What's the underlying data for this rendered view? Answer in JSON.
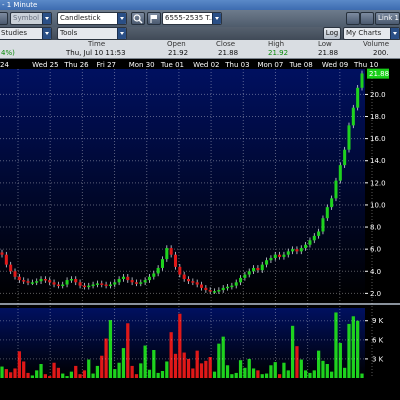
{
  "window": {
    "title": "- 1 Minute"
  },
  "toolbar": {
    "symbol_placeholder": "Symbol 2",
    "chart_type": "Candlestick",
    "account": "6555-2535 T...",
    "link": "Link 1",
    "studies": "Studies",
    "tools": "Tools",
    "log": "Log",
    "my_charts": "My Charts"
  },
  "quote": {
    "change": "4%)",
    "headers": {
      "time": "Time",
      "open": "Open",
      "close": "Close",
      "high": "High",
      "low": "Low",
      "volume": "Volume"
    },
    "values": {
      "time": "Thu, Jul 10  11:53",
      "open": "21.92",
      "close": "21.88",
      "high": "21.92",
      "low": "21.88",
      "volume": "200."
    }
  },
  "colors": {
    "up": "#1ed21e",
    "down": "#e01818",
    "plot_bg_top": "#001060",
    "plot_bg_bottom": "#000000",
    "last_price_bg": "#18d018"
  },
  "chart_data": {
    "type": "candlestick",
    "x_labels": [
      "24",
      "Wed 25",
      "Thu 26",
      "Fri 27",
      "Mon 30",
      "Tue 01",
      "Wed 02",
      "Thu 03",
      "Mon 07",
      "Tue 08",
      "Wed 09",
      "Thu 10"
    ],
    "y_ticks": [
      "2.0",
      "4.0",
      "6.0",
      "8.0",
      "10.0",
      "12.0",
      "14.0",
      "16.0",
      "18.0",
      "20.0"
    ],
    "ylim": [
      1.4,
      22.3
    ],
    "last_price": "21.88",
    "volume_ticks": [
      "3 K",
      "6 K",
      "9 K"
    ],
    "volume_ylim": [
      0,
      11000
    ],
    "series": [
      {
        "values": [
          5.5,
          4.6,
          4.0,
          3.5,
          3.2,
          3.1,
          3.0,
          3.0,
          3.1,
          3.3,
          3.2,
          3.0,
          2.8,
          2.7,
          2.8,
          3.2,
          3.3,
          3.0,
          2.7,
          2.6,
          2.7,
          2.8,
          2.9,
          2.8,
          2.7,
          2.8,
          3.0,
          3.3,
          3.5,
          3.2,
          3.0,
          2.9,
          3.0,
          3.2,
          3.5,
          3.8,
          4.3,
          5.1,
          6.1,
          5.5,
          4.4,
          3.7,
          3.3,
          3.1,
          3.0,
          2.8,
          2.5,
          2.3,
          2.2,
          2.2,
          2.3,
          2.5,
          2.6,
          2.7,
          3.0,
          3.4,
          3.7,
          4.0,
          4.3,
          4.1,
          4.6,
          5.0,
          5.2,
          5.5,
          5.3,
          5.5,
          5.8,
          6.0,
          5.8,
          6.1,
          6.4,
          6.8,
          7.2,
          7.6,
          8.8,
          9.8,
          10.6,
          12.2,
          13.6,
          15.0,
          17.2,
          18.8,
          20.6,
          21.9
        ],
        "volumes": [
          1800,
          1400,
          900,
          1500,
          4200,
          2600,
          800,
          400,
          1200,
          2200,
          600,
          300,
          2400,
          1600,
          700,
          300,
          1000,
          1900,
          600,
          1200,
          2900,
          700,
          1900,
          3500,
          6200,
          9100,
          1400,
          2400,
          4700,
          8600,
          1900,
          600,
          2300,
          5100,
          1300,
          4400,
          800,
          1100,
          2600,
          7200,
          3800,
          10100,
          4000,
          3000,
          1500,
          4300,
          2300,
          2700,
          3300,
          1000,
          5400,
          6500,
          2000,
          600,
          800,
          2800,
          1600,
          3000,
          1500,
          1200,
          600,
          700,
          2000,
          2500,
          600,
          2400,
          1200,
          8200,
          5000,
          2900,
          1200,
          800,
          1200,
          4300,
          2700,
          2200,
          1000,
          10300,
          5500,
          1600,
          8500,
          9700,
          9000,
          700
        ]
      }
    ]
  }
}
